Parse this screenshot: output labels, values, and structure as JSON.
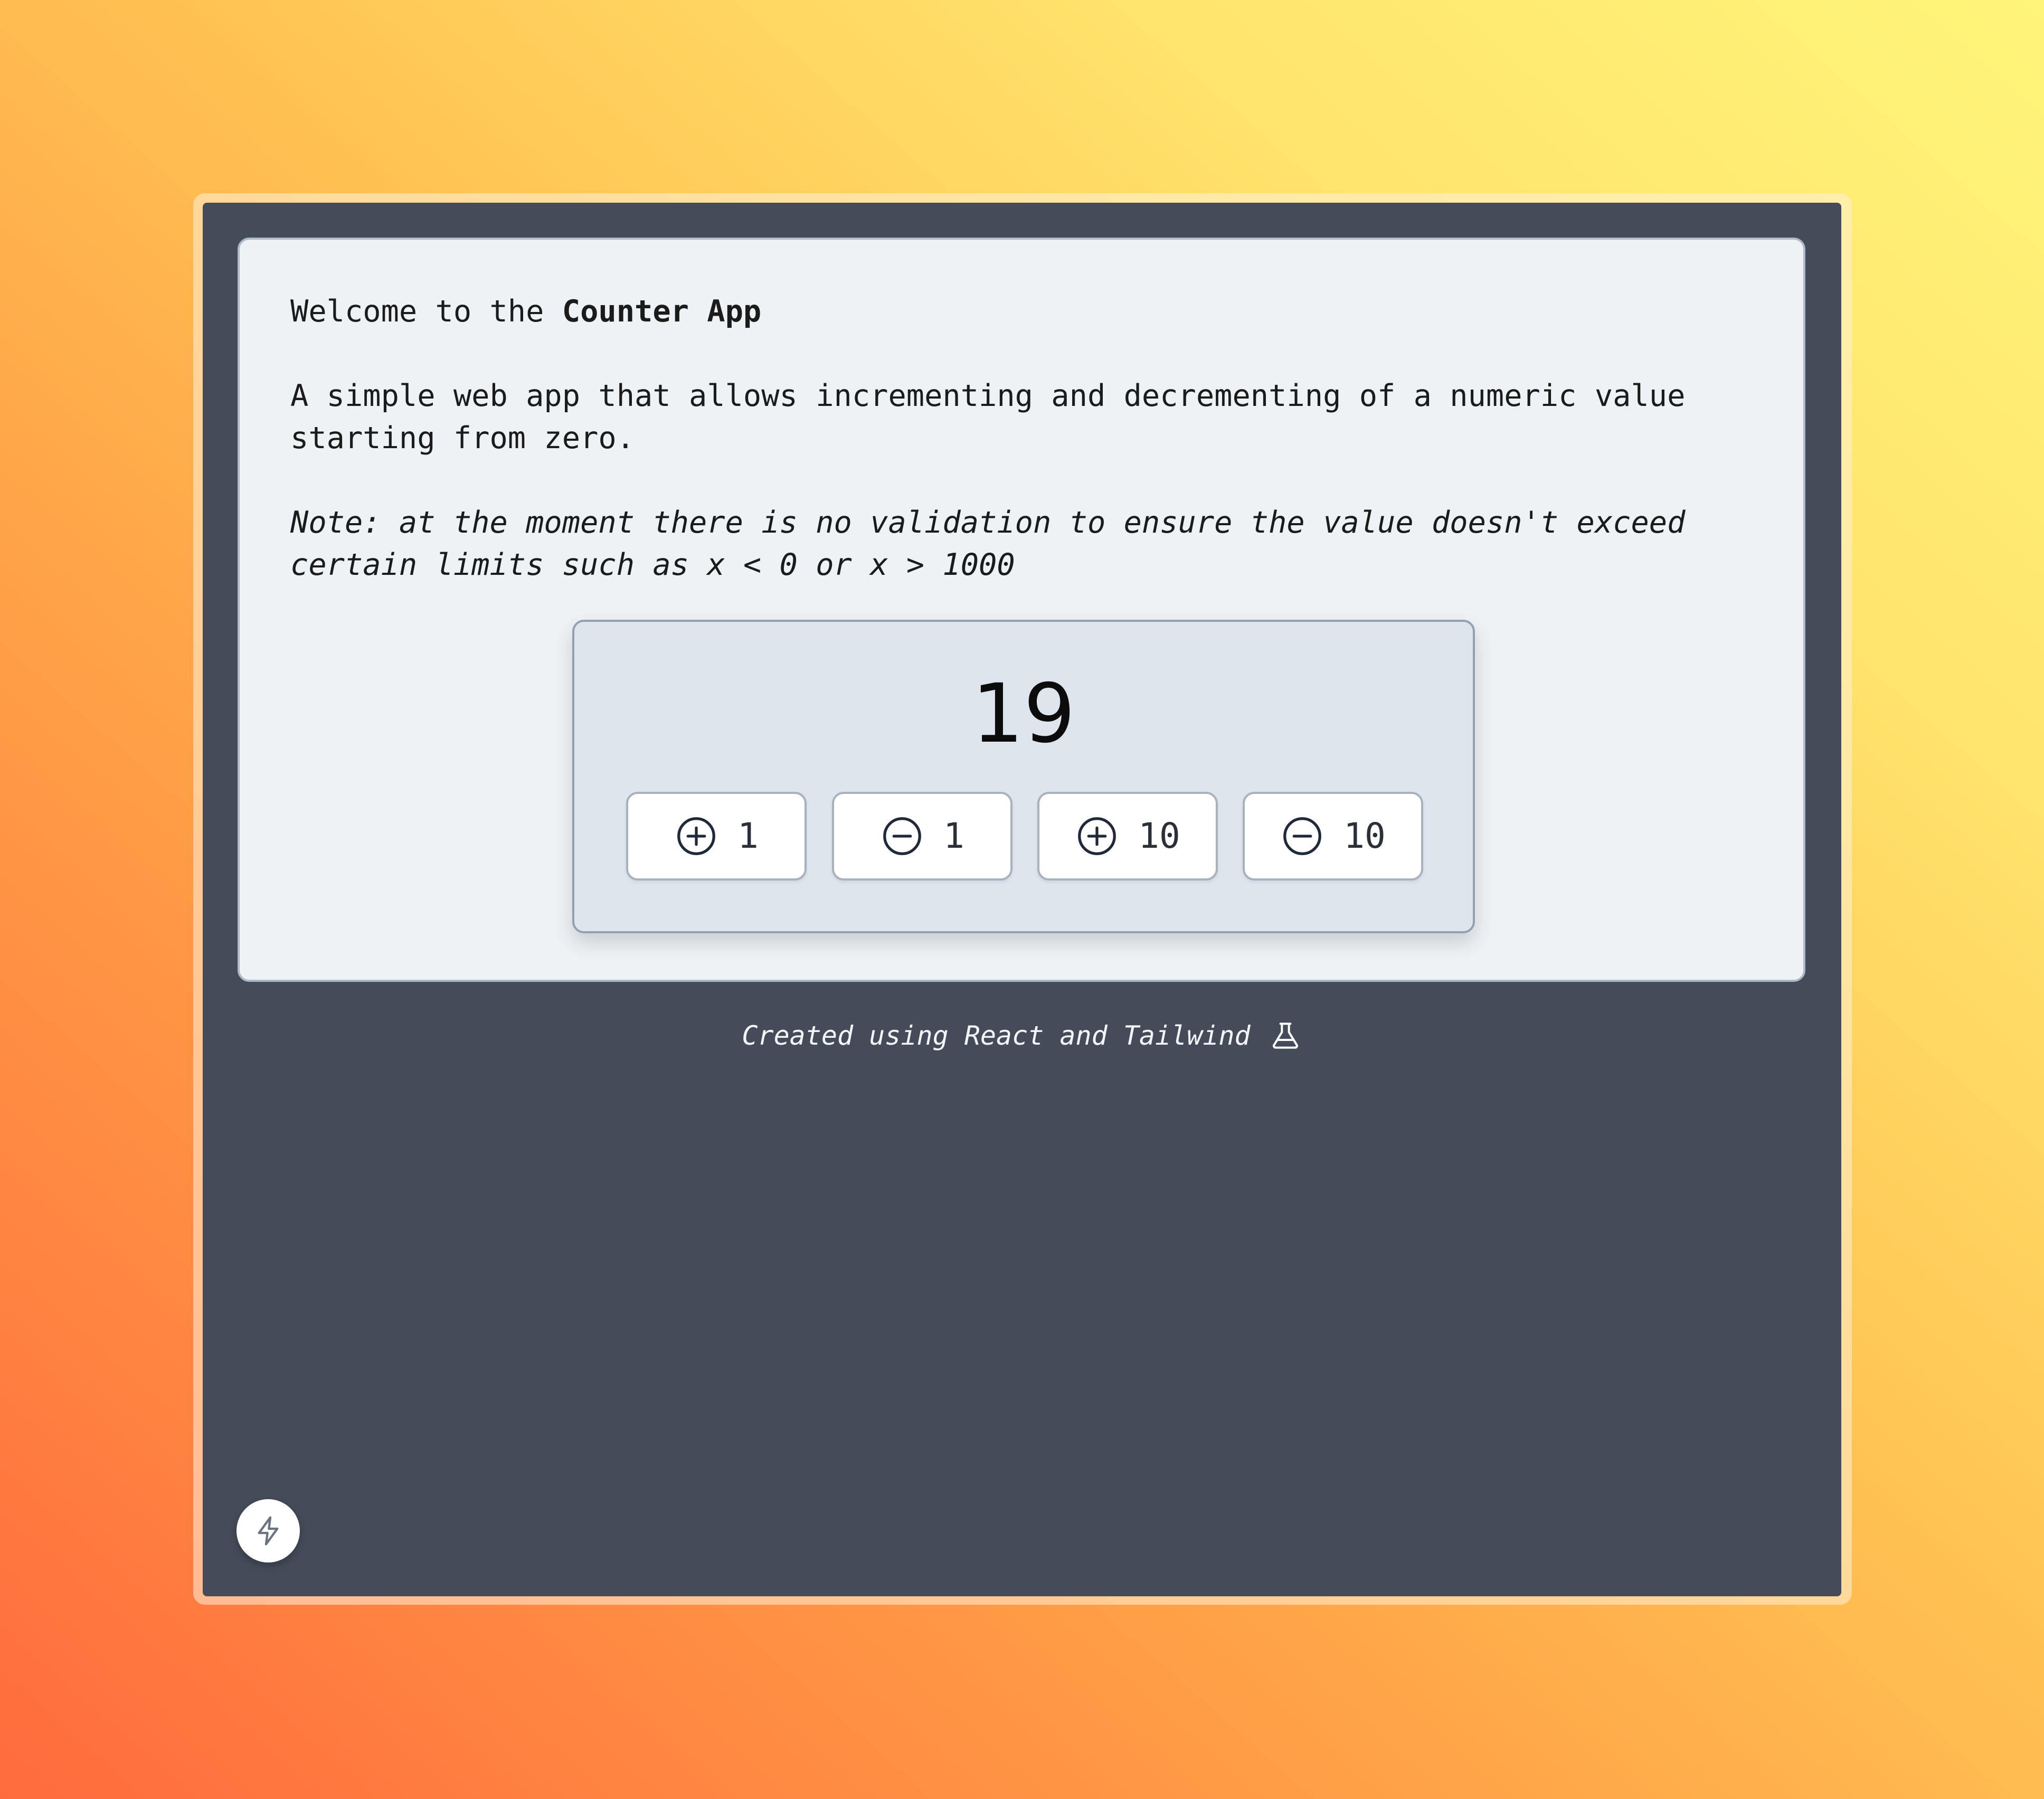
{
  "intro": {
    "welcome_prefix": "Welcome to the ",
    "app_name": "Counter App",
    "description": "A simple web app that allows incrementing and decrementing of a numeric value starting from zero.",
    "note": "Note: at the moment there is no validation to ensure the value doesn't exceed certain limits such as x < 0 or x > 1000"
  },
  "counter": {
    "value": "19",
    "buttons": [
      {
        "icon": "plus-circle-icon",
        "label": "1"
      },
      {
        "icon": "minus-circle-icon",
        "label": "1"
      },
      {
        "icon": "plus-circle-icon",
        "label": "10"
      },
      {
        "icon": "minus-circle-icon",
        "label": "10"
      }
    ]
  },
  "footer": {
    "text": "Created using React and Tailwind",
    "icon": "flask-icon"
  },
  "fab": {
    "icon": "lightning-icon"
  },
  "colors": {
    "window_bg": "#444c5a",
    "card_bg": "#eef2f4",
    "counter_bg": "#dfe5ed"
  }
}
